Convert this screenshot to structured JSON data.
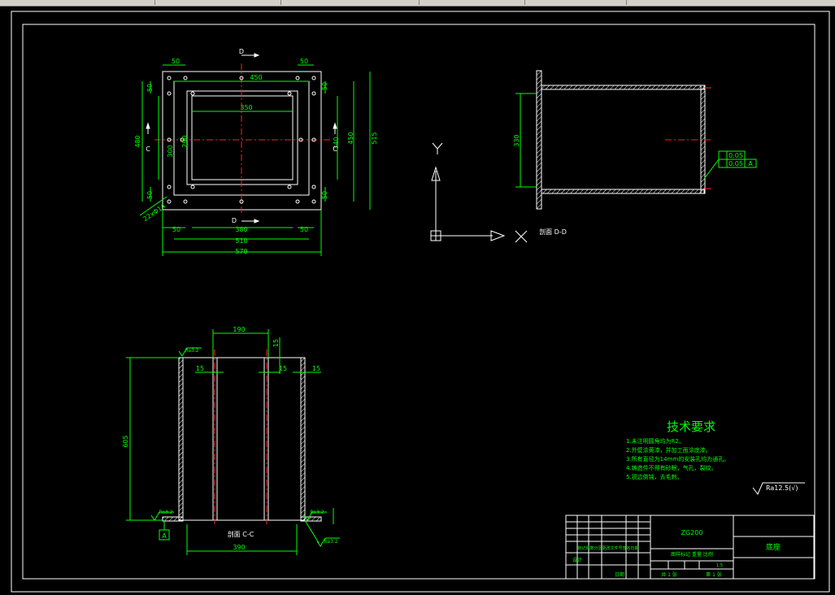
{
  "app": {
    "title": ""
  },
  "colors": {
    "bg": "#000000",
    "line": "#ffffff",
    "dim": "#00ff00",
    "center": "#ff2020",
    "hatch": "#ffffff"
  },
  "plan_view": {
    "dims": {
      "top_50_left": "50",
      "top_50_right": "50",
      "d450": "450",
      "d350": "350",
      "left_50_top": "50",
      "left_480": "480",
      "left_300": "300",
      "left_50_bot": "50",
      "right_50_top": "50",
      "right_340": "340",
      "right_450": "450",
      "right_515": "515",
      "right_50_bot": "50",
      "bot_50_left": "50",
      "bot_380": "380",
      "bot_50_right": "50",
      "d510": "510",
      "d570": "570",
      "d290": "290",
      "holes": "22xΦ14"
    },
    "sections": {
      "top": "D",
      "bottom": "D",
      "left": "C",
      "right": "C"
    }
  },
  "ucs": {
    "y": "Y",
    "x": "X"
  },
  "section_d": {
    "label": "剖面 D-D",
    "dim_330": "330",
    "tol1": "0.05",
    "tol2": "0.05",
    "datum": "A"
  },
  "section_c": {
    "label": "剖面 C-C",
    "dim_190": "190",
    "dim_15_top": "15",
    "dim_15_a": "15",
    "dim_15_b": "15",
    "dim_15_c": "15",
    "dim_605": "605",
    "dim_390": "390",
    "rough1": "Ra3.2",
    "rough2": "Ra3.2",
    "rough3": "Ra3.2",
    "rough4": "Ra3.2",
    "datum": "A"
  },
  "tech": {
    "title": "技术要求",
    "items": [
      "1.未注明圆角均为R2。",
      "2.外壁涂黄漆，并加工面涂底漆。",
      "3.所有直径为14mm的安装孔均为通孔。",
      "4.铸造件不得有砂眼，气孔，裂纹。",
      "5.锐边倒钝，去毛刺。"
    ],
    "roughness": "Ra12.5(√)"
  },
  "title_block": {
    "drawing_no": "ZG200",
    "name": "底座",
    "scale_hdr": "图样标记 重量 比例",
    "sheet_left": "共 1 张",
    "sheet_right": "第 1 张",
    "design": "设计",
    "date": "日期",
    "rev": "标记处数分区更改文件号签名日期",
    "ratio": "1:5"
  }
}
